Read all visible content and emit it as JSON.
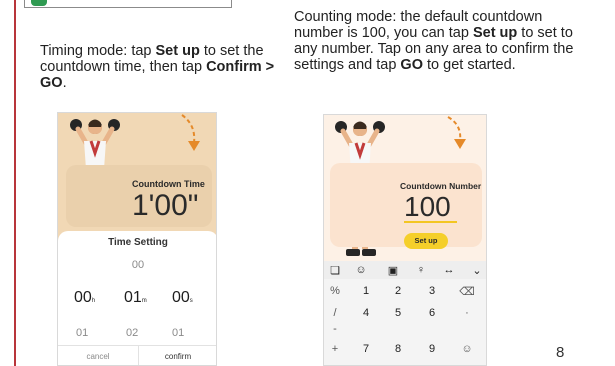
{
  "left": {
    "caption_a": "Timing mode: tap ",
    "caption_setup": "Set up",
    "caption_b": " to set the countdown time, then tap ",
    "caption_confirm": "Confirm > GO",
    "caption_c": ".",
    "card_title": "Countdown Time",
    "card_value": "1'00\"",
    "sheet_title": "Time Setting",
    "picker_above": "00",
    "hours": "00",
    "hours_unit": "h",
    "minutes": "01",
    "minutes_unit": "m",
    "seconds": "00",
    "seconds_unit": "s",
    "below_1": "01",
    "below_2": "02",
    "below_3": "01",
    "cancel": "cancel",
    "confirm": "confirm"
  },
  "right": {
    "caption_a": "Counting mode: the default countdown number is 100, you can tap ",
    "caption_setup": "Set up",
    "caption_b": " to set to any number.  Tap on any area to confirm the settings and tap ",
    "caption_go": "GO",
    "caption_c": " to get started.",
    "card_title": "Countdown Number",
    "card_value": "100",
    "setup_button": "Set up",
    "keys": [
      [
        "%",
        "1",
        "2",
        "3",
        "⌫"
      ],
      [
        "/",
        "4",
        "5",
        "6",
        "·"
      ],
      [
        "-",
        "",
        "",
        "",
        ""
      ],
      [
        "+",
        "7",
        "8",
        "9",
        "☺"
      ]
    ]
  },
  "page_number": "8"
}
